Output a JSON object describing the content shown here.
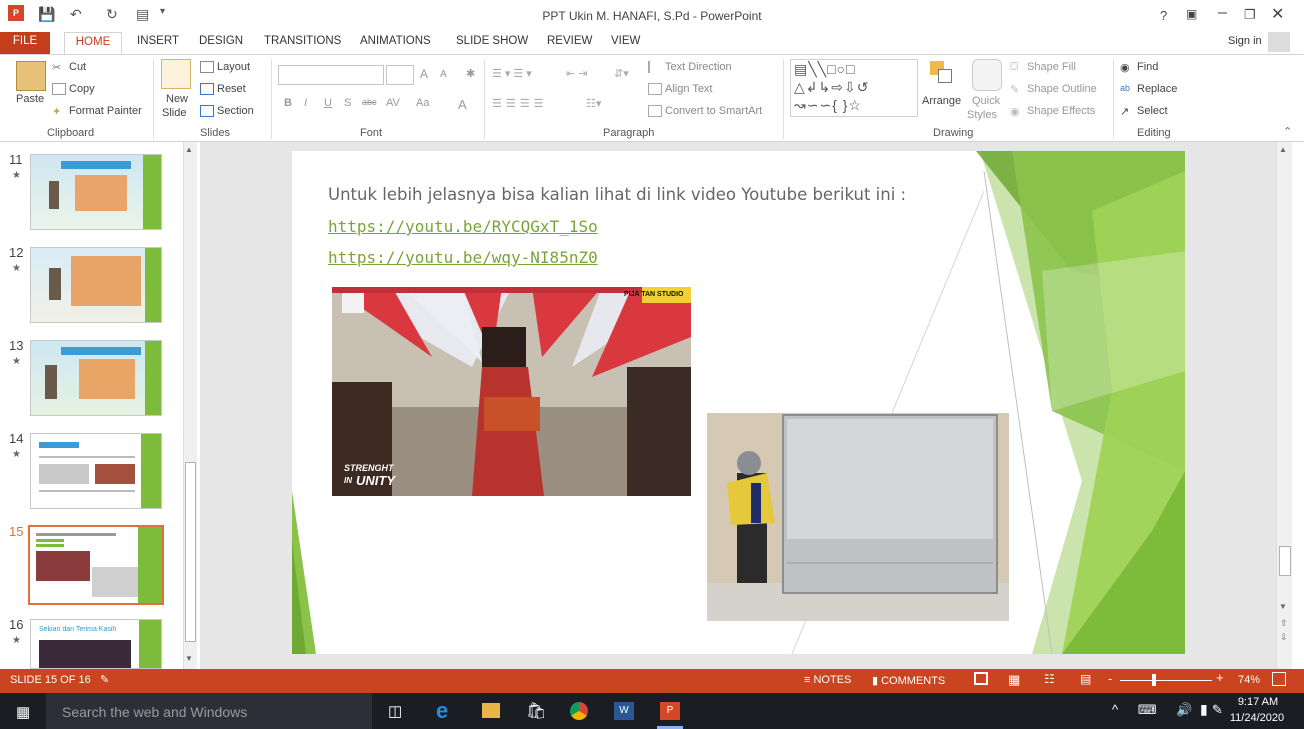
{
  "window": {
    "title": "PPT Ukin M. HANAFI, S.Pd - PowerPoint",
    "help": "?",
    "signin": "Sign in"
  },
  "tabs": [
    "FILE",
    "HOME",
    "INSERT",
    "DESIGN",
    "TRANSITIONS",
    "ANIMATIONS",
    "SLIDE SHOW",
    "REVIEW",
    "VIEW"
  ],
  "ribbon": {
    "clipboard": {
      "paste": "Paste",
      "cut": "Cut",
      "copy": "Copy",
      "format_painter": "Format Painter",
      "label": "Clipboard"
    },
    "slides": {
      "new_slide_1": "New",
      "new_slide_2": "Slide",
      "layout": "Layout",
      "reset": "Reset",
      "section": "Section",
      "label": "Slides"
    },
    "font": {
      "label": "Font",
      "bold": "B",
      "italic": "I",
      "underline": "U",
      "shadow": "S",
      "strike": "abc",
      "spacing": "AV",
      "case": "Aa",
      "color": "A",
      "grow": "A",
      "shrink": "A"
    },
    "paragraph": {
      "label": "Paragraph",
      "text_direction": "Text Direction",
      "align_text": "Align Text",
      "convert": "Convert to SmartArt"
    },
    "drawing": {
      "label": "Drawing",
      "arrange": "Arrange",
      "quick_1": "Quick",
      "quick_2": "Styles",
      "shape_fill": "Shape Fill",
      "shape_outline": "Shape Outline",
      "shape_effects": "Shape Effects"
    },
    "editing": {
      "label": "Editing",
      "find": "Find",
      "replace": "Replace",
      "select": "Select"
    }
  },
  "thumbnails": [
    {
      "num": "11",
      "top": 0
    },
    {
      "num": "12"
    },
    {
      "num": "13"
    },
    {
      "num": "14"
    },
    {
      "num": "15"
    },
    {
      "num": "16",
      "caption": "Sekian dan Terima Kasih"
    }
  ],
  "slide": {
    "heading": "Untuk lebih jelasnya bisa kalian lihat di link video Youtube berikut ini :",
    "link1": "https://youtu.be/RYCQGxT_1So",
    "link2": "https://youtu.be/wqy-NI85nZ0",
    "photo1_badge": "PIJA TAN STUDIO",
    "photo1_caption_1": "STRENGHT",
    "photo1_caption_2": "UNITY",
    "photo1_caption_in": "IN"
  },
  "status": {
    "slide": "SLIDE 15 OF 16",
    "notes": "NOTES",
    "comments": "COMMENTS",
    "zoom": "74%"
  },
  "taskbar": {
    "search": "Search the web and Windows",
    "time": "9:17 AM",
    "date": "11/24/2020"
  },
  "colors": {
    "accent": "#c43e1c",
    "slide_green": "#8bc34a",
    "link_green": "#79a537"
  }
}
